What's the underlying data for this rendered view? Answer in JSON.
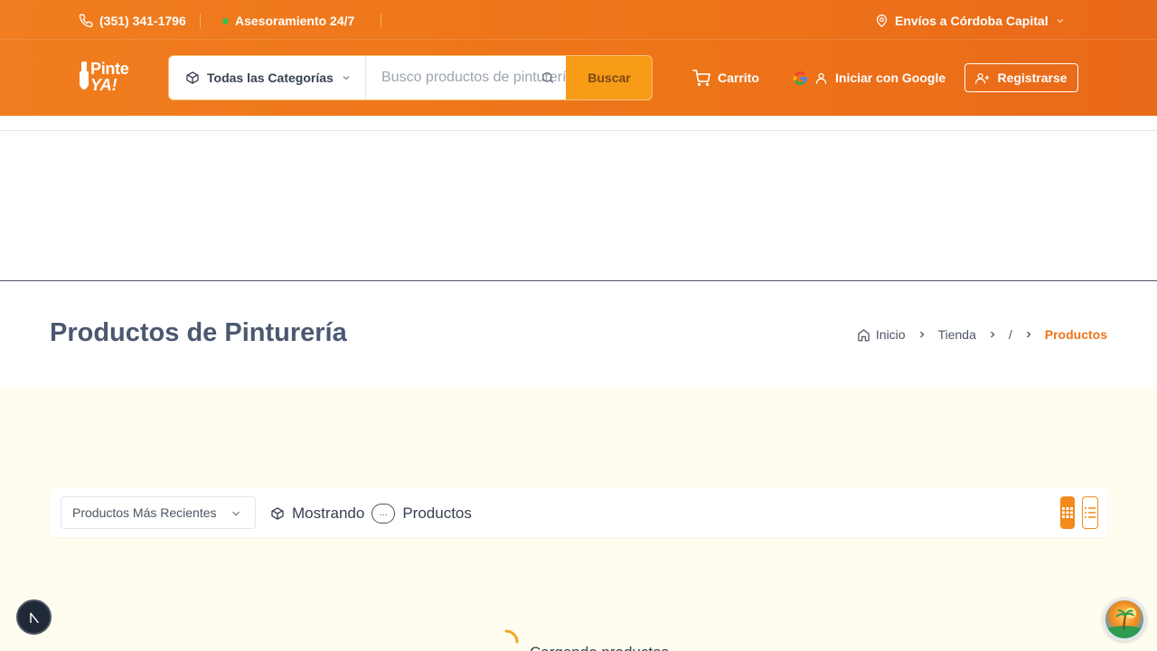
{
  "topbar": {
    "phone": "(351) 341-1796",
    "support": "Asesoramiento 24/7",
    "shipping": "Envíos a Córdoba Capital"
  },
  "logo": {
    "line1": "Pinte",
    "line2": "YA!"
  },
  "search": {
    "category_label": "Todas las Categorías",
    "placeholder": "Busco productos de pinturería",
    "button": "Buscar"
  },
  "header": {
    "cart": "Carrito",
    "login": "Iniciar con Google",
    "register": "Registrarse"
  },
  "page": {
    "title": "Productos de Pinturería",
    "breadcrumb": [
      "Inicio",
      "Tienda",
      "/",
      "Productos"
    ]
  },
  "toolbar": {
    "sort_selected": "Productos Más Recientes",
    "showing_prefix": "Mostrando",
    "showing_count": "...",
    "showing_suffix": "Productos"
  },
  "loading": {
    "text": "Cargando productos..."
  },
  "colors": {
    "brand_orange": "#ee7418",
    "button_orange": "#f89c17",
    "cream_bg": "#fffdf0",
    "title_slate": "#4b5870"
  }
}
